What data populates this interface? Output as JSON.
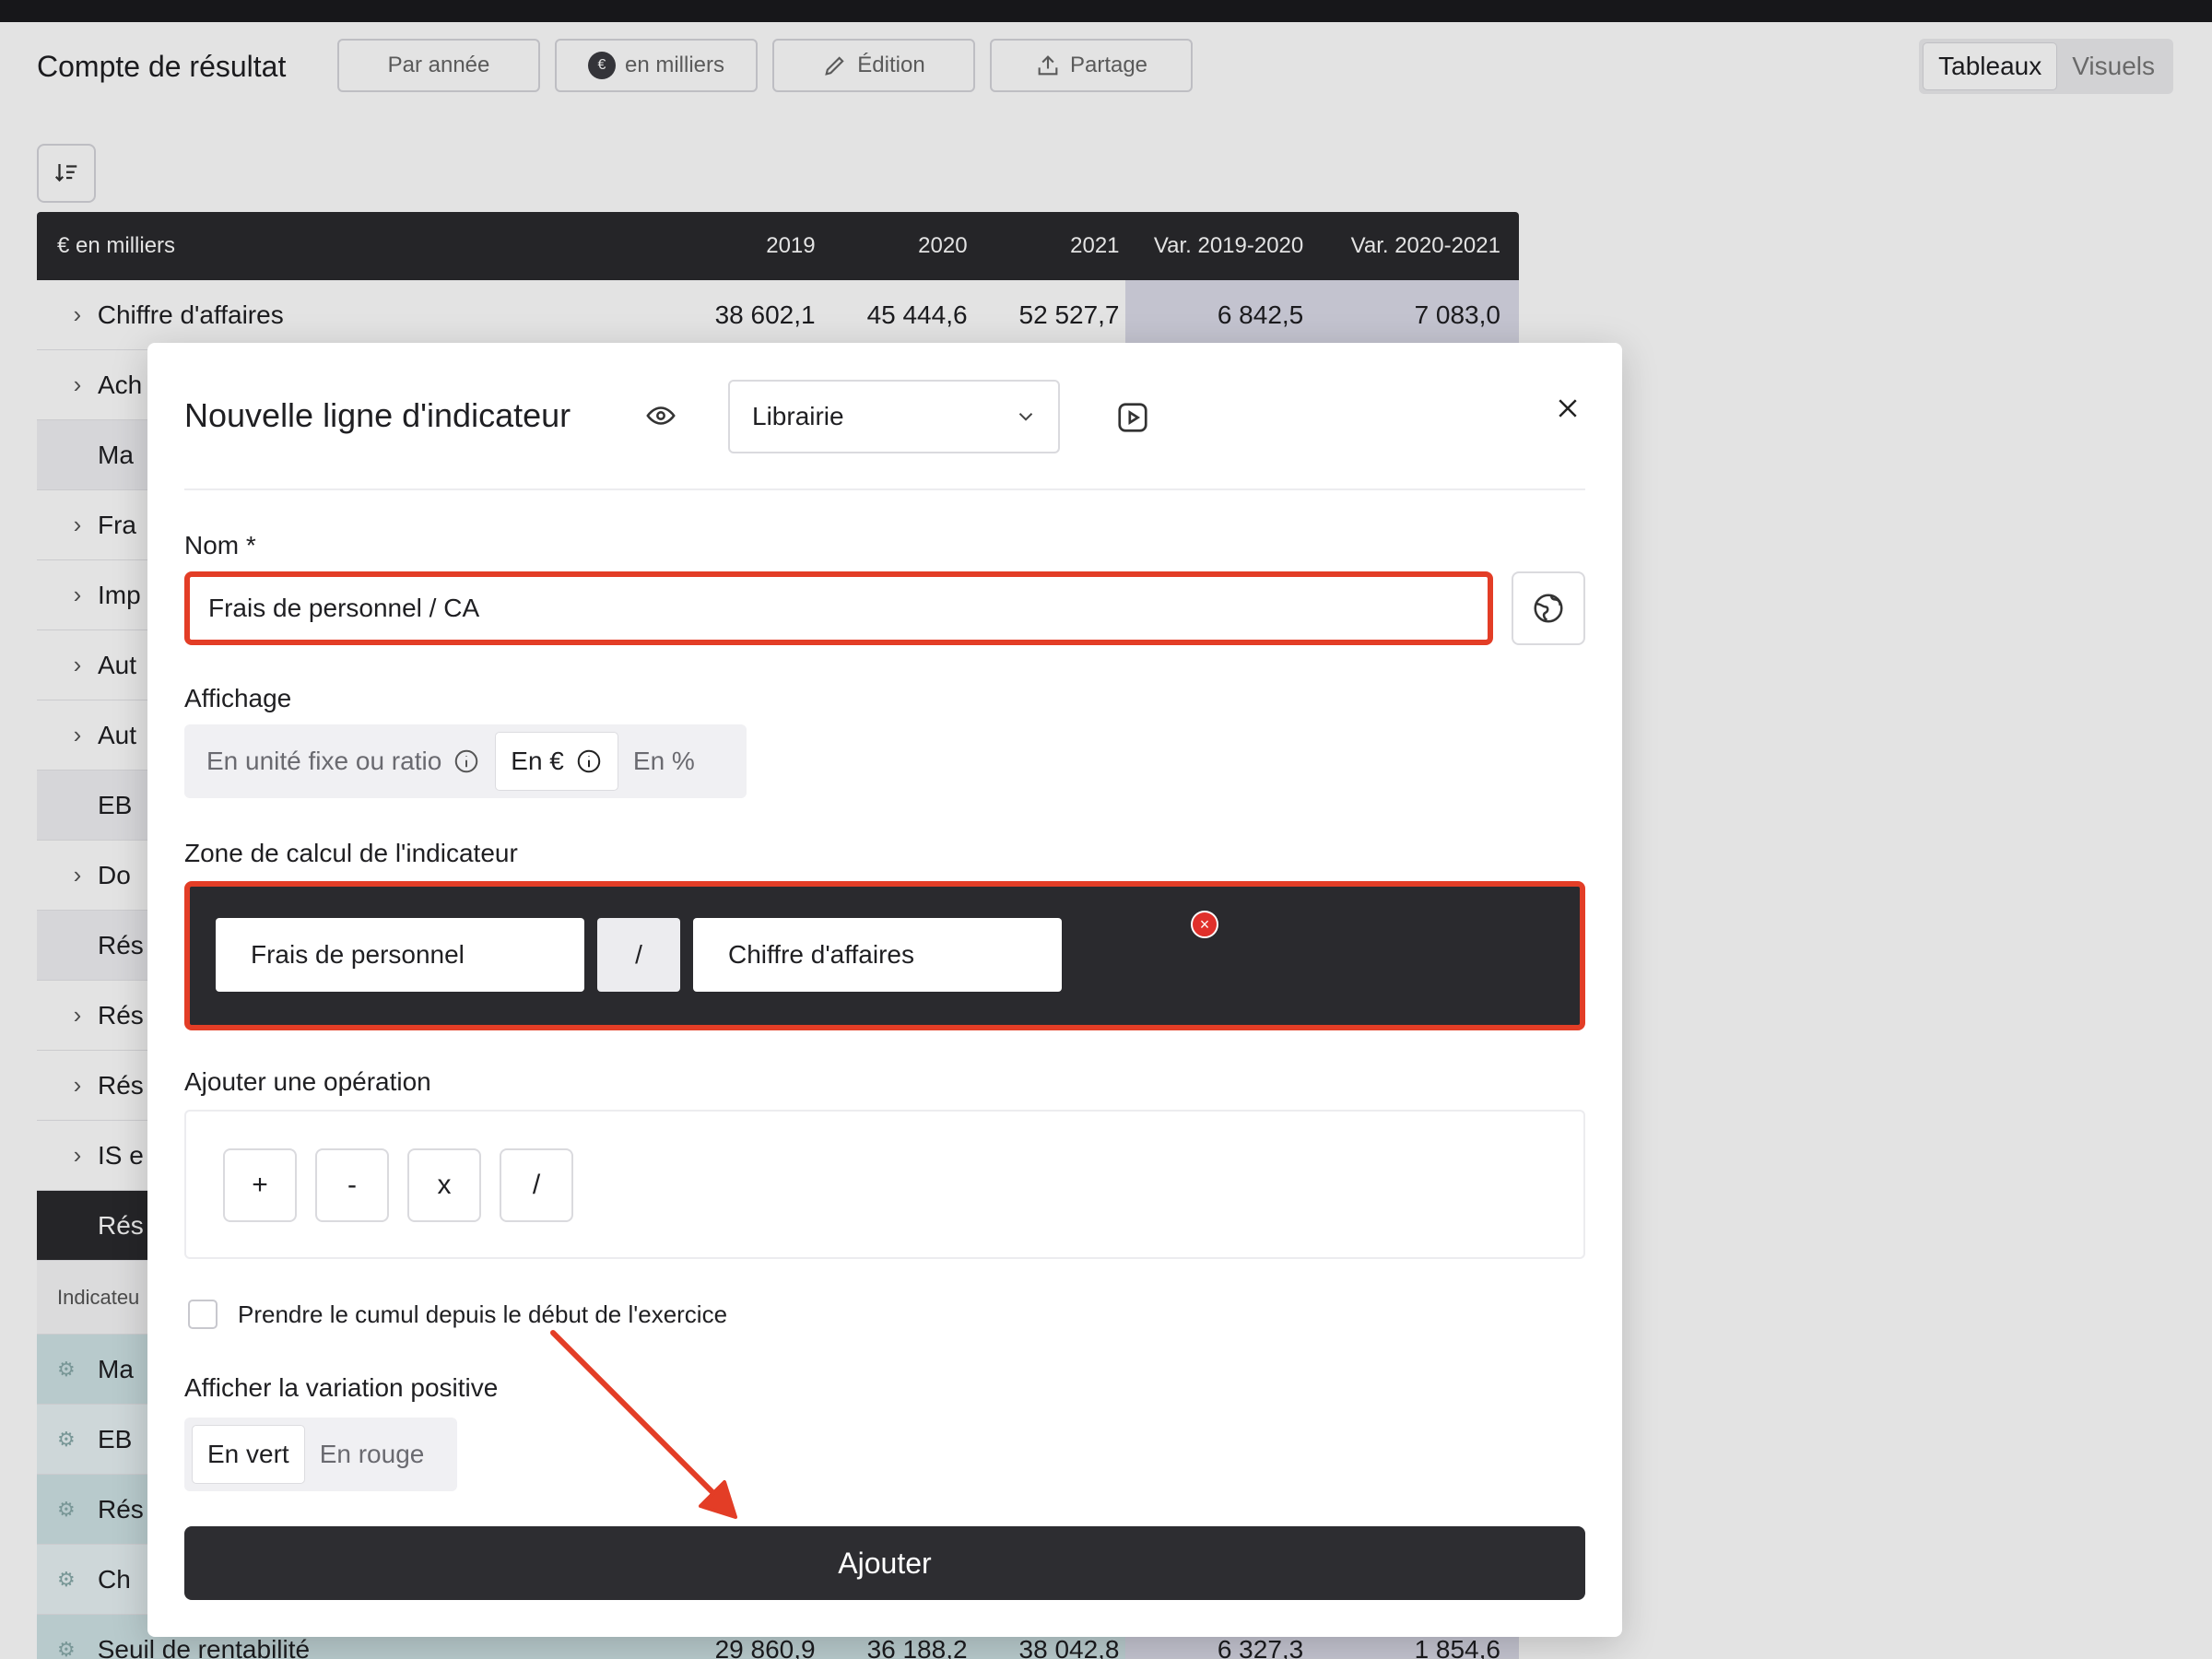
{
  "app": {
    "title": "Compte de résultat",
    "toolbar": {
      "per_year": "Par année",
      "unit": "en milliers",
      "edit": "Édition",
      "share": "Partage"
    },
    "view_tabs": [
      "Tableaux",
      "Visuels"
    ],
    "active_view": "Tableaux"
  },
  "table": {
    "header": [
      "€ en milliers",
      "2019",
      "2020",
      "2021",
      "Var. 2019-2020",
      "Var. 2020-2021"
    ],
    "rows": [
      {
        "label": "Chiffre d'affaires",
        "values": [
          "38 602,1",
          "45 444,6",
          "52 527,7",
          "6 842,5",
          "7 083,0"
        ]
      },
      {
        "label": "Ach"
      },
      {
        "label": "Ma"
      },
      {
        "label": "Fra"
      },
      {
        "label": "Imp"
      },
      {
        "label": "Aut"
      },
      {
        "label": "Aut"
      },
      {
        "label": "EB"
      },
      {
        "label": "Do"
      },
      {
        "label": "Rés"
      },
      {
        "label": "Rés"
      },
      {
        "label": "Rés"
      },
      {
        "label": "IS e"
      },
      {
        "label": "Rés"
      }
    ],
    "indicators_header": "Indicateu",
    "indicator_rows": [
      {
        "label": "Ma"
      },
      {
        "label": "EB"
      },
      {
        "label": "Rés"
      },
      {
        "label": "Ch"
      },
      {
        "label": "Seuil de rentabilité",
        "values": [
          "29 860,9",
          "36 188,2",
          "38 042,8",
          "6 327,3",
          "1 854,6"
        ]
      }
    ]
  },
  "modal": {
    "title": "Nouvelle ligne d'indicateur",
    "library_select": "Librairie",
    "name_label": "Nom *",
    "name_value": "Frais de personnel / CA",
    "display_label": "Affichage",
    "display_options": [
      "En unité fixe ou ratio",
      "En €",
      "En %"
    ],
    "display_selected": "En €",
    "calc_label": "Zone de calcul de l'indicateur",
    "calc_tokens": [
      "Frais de personnel",
      "/",
      "Chiffre d'affaires"
    ],
    "ops_label": "Ajouter une opération",
    "ops": [
      "+",
      "-",
      "x",
      "/"
    ],
    "cumul_label": "Prendre le cumul depuis le début de l'exercice",
    "cumul_checked": false,
    "variation_label": "Afficher la variation positive",
    "variation_options": [
      "En vert",
      "En rouge"
    ],
    "variation_selected": "En vert",
    "submit": "Ajouter"
  },
  "colors": {
    "highlight": "#e33d26",
    "dark": "#2a2a2e",
    "variance_bg": "#dcdbe9"
  }
}
